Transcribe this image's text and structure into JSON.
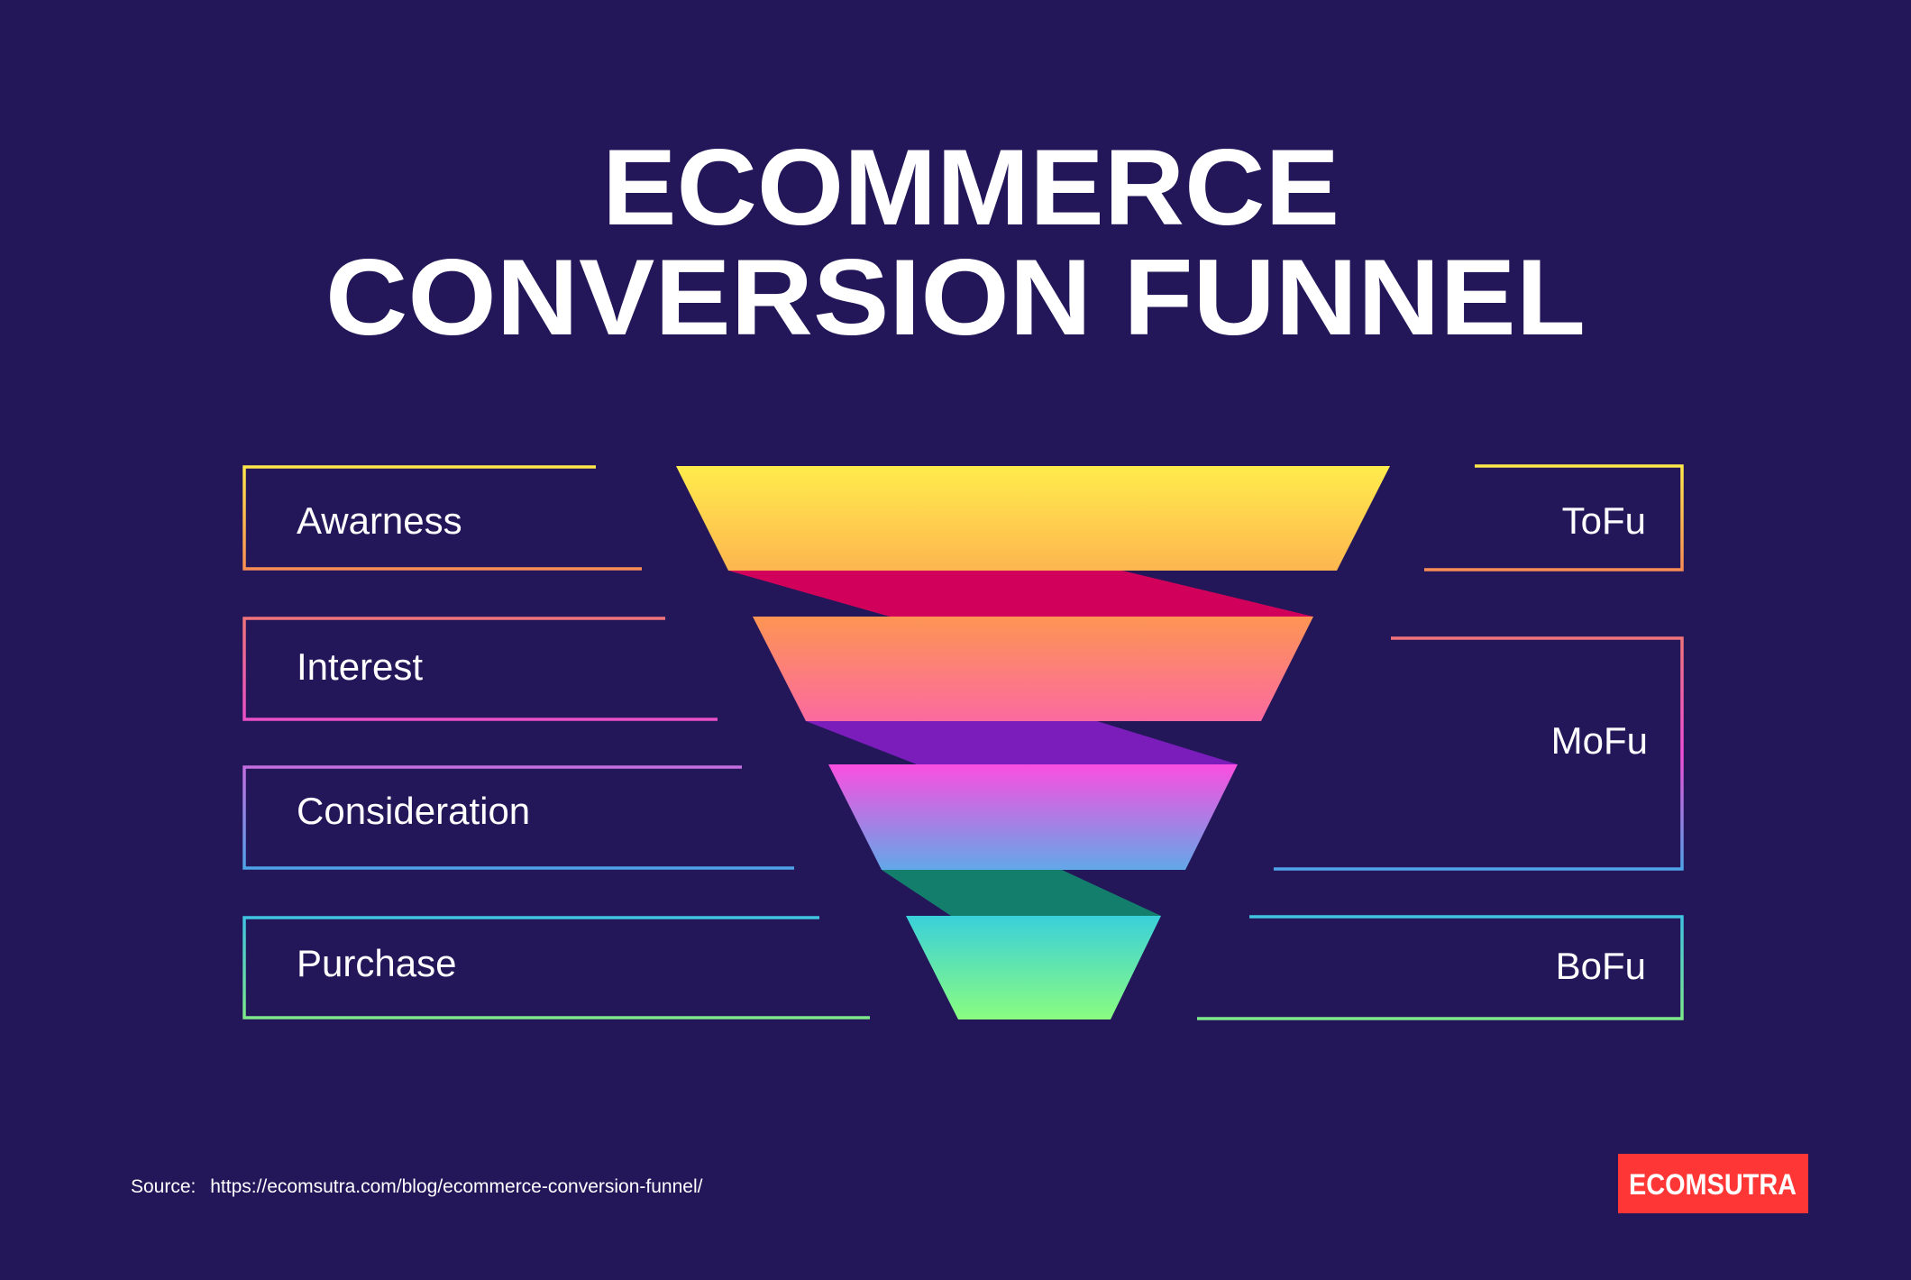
{
  "title": {
    "line1": "ECOMMERCE",
    "line2": "CONVERSION FUNNEL"
  },
  "colors": {
    "background": "#23175a",
    "logo_bg": "#ff3636"
  },
  "funnel": {
    "stages": [
      {
        "label": "Awarness",
        "gradient": [
          "#ffec4c",
          "#fdb64f"
        ]
      },
      {
        "label": "Interest",
        "gradient": [
          "#fd9553",
          "#fb6aa0"
        ]
      },
      {
        "label": "Consideration",
        "gradient": [
          "#fb4ee0",
          "#62a8e8"
        ]
      },
      {
        "label": "Purchase",
        "gradient": [
          "#3ad0da",
          "#8afc80"
        ]
      }
    ],
    "connectors": [
      {
        "color": "#d1005a"
      },
      {
        "color": "#7a1dbb"
      },
      {
        "color": "#147e6c"
      }
    ]
  },
  "left_boxes": [
    {
      "label": "Awarness",
      "gradient": [
        "#ffe84a",
        "#f98c55"
      ]
    },
    {
      "label": "Interest",
      "gradient": [
        "#f0747a",
        "#e94fc8"
      ]
    },
    {
      "label": "Consideration",
      "gradient": [
        "#c56ee0",
        "#4fa3e8"
      ]
    },
    {
      "label": "Purchase",
      "gradient": [
        "#3fc3e0",
        "#7ee88a"
      ]
    }
  ],
  "right_boxes": [
    {
      "label": "ToFu",
      "gradient": [
        "#ffe84a",
        "#f98c55"
      ]
    },
    {
      "label": "MoFu",
      "gradient": [
        "#f0747a",
        "#f04fd6",
        "#4fa3e8"
      ]
    },
    {
      "label": "BoFu",
      "gradient": [
        "#3fc3e0",
        "#7ee88a"
      ]
    }
  ],
  "footer": {
    "source_label": "Source:",
    "source_url": "https://ecomsutra.com/blog/ecommerce-conversion-funnel/",
    "logo": "ECOMSUTRA"
  }
}
